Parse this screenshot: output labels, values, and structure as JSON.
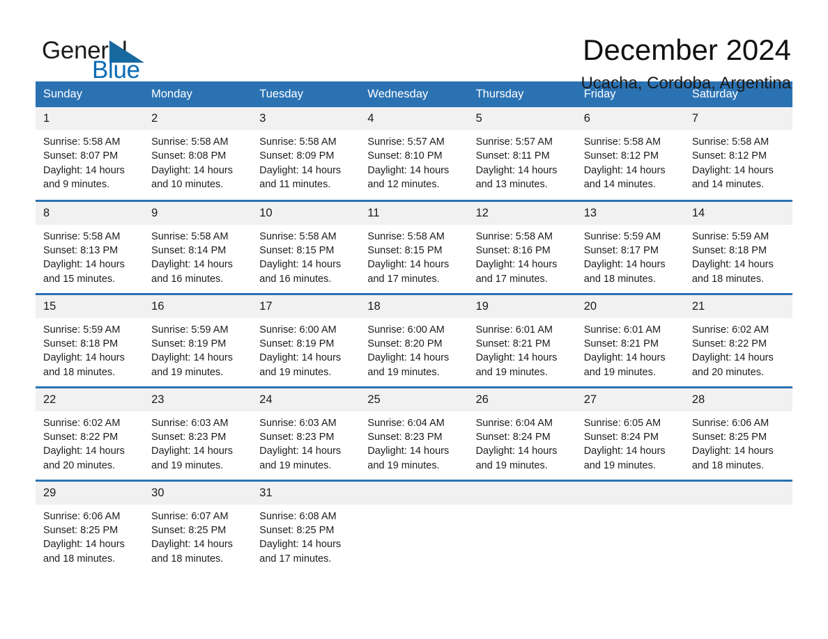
{
  "brand": {
    "name_part1": "General",
    "name_part2": "Blue",
    "triangle_color": "#17699f",
    "blue_color": "#0d6cb5"
  },
  "header": {
    "month_title": "December 2024",
    "location": "Ucacha, Cordoba, Argentina"
  },
  "theme": {
    "header_blue": "#2b72b3",
    "daynum_gray": "#f1f1f1",
    "text_dark": "#1c1c1c"
  },
  "calendar": {
    "weekday_headers": [
      "Sunday",
      "Monday",
      "Tuesday",
      "Wednesday",
      "Thursday",
      "Friday",
      "Saturday"
    ],
    "weeks": [
      [
        {
          "day": "1",
          "sunrise": "Sunrise: 5:58 AM",
          "sunset": "Sunset: 8:07 PM",
          "daylight_l1": "Daylight: 14 hours",
          "daylight_l2": "and 9 minutes."
        },
        {
          "day": "2",
          "sunrise": "Sunrise: 5:58 AM",
          "sunset": "Sunset: 8:08 PM",
          "daylight_l1": "Daylight: 14 hours",
          "daylight_l2": "and 10 minutes."
        },
        {
          "day": "3",
          "sunrise": "Sunrise: 5:58 AM",
          "sunset": "Sunset: 8:09 PM",
          "daylight_l1": "Daylight: 14 hours",
          "daylight_l2": "and 11 minutes."
        },
        {
          "day": "4",
          "sunrise": "Sunrise: 5:57 AM",
          "sunset": "Sunset: 8:10 PM",
          "daylight_l1": "Daylight: 14 hours",
          "daylight_l2": "and 12 minutes."
        },
        {
          "day": "5",
          "sunrise": "Sunrise: 5:57 AM",
          "sunset": "Sunset: 8:11 PM",
          "daylight_l1": "Daylight: 14 hours",
          "daylight_l2": "and 13 minutes."
        },
        {
          "day": "6",
          "sunrise": "Sunrise: 5:58 AM",
          "sunset": "Sunset: 8:12 PM",
          "daylight_l1": "Daylight: 14 hours",
          "daylight_l2": "and 14 minutes."
        },
        {
          "day": "7",
          "sunrise": "Sunrise: 5:58 AM",
          "sunset": "Sunset: 8:12 PM",
          "daylight_l1": "Daylight: 14 hours",
          "daylight_l2": "and 14 minutes."
        }
      ],
      [
        {
          "day": "8",
          "sunrise": "Sunrise: 5:58 AM",
          "sunset": "Sunset: 8:13 PM",
          "daylight_l1": "Daylight: 14 hours",
          "daylight_l2": "and 15 minutes."
        },
        {
          "day": "9",
          "sunrise": "Sunrise: 5:58 AM",
          "sunset": "Sunset: 8:14 PM",
          "daylight_l1": "Daylight: 14 hours",
          "daylight_l2": "and 16 minutes."
        },
        {
          "day": "10",
          "sunrise": "Sunrise: 5:58 AM",
          "sunset": "Sunset: 8:15 PM",
          "daylight_l1": "Daylight: 14 hours",
          "daylight_l2": "and 16 minutes."
        },
        {
          "day": "11",
          "sunrise": "Sunrise: 5:58 AM",
          "sunset": "Sunset: 8:15 PM",
          "daylight_l1": "Daylight: 14 hours",
          "daylight_l2": "and 17 minutes."
        },
        {
          "day": "12",
          "sunrise": "Sunrise: 5:58 AM",
          "sunset": "Sunset: 8:16 PM",
          "daylight_l1": "Daylight: 14 hours",
          "daylight_l2": "and 17 minutes."
        },
        {
          "day": "13",
          "sunrise": "Sunrise: 5:59 AM",
          "sunset": "Sunset: 8:17 PM",
          "daylight_l1": "Daylight: 14 hours",
          "daylight_l2": "and 18 minutes."
        },
        {
          "day": "14",
          "sunrise": "Sunrise: 5:59 AM",
          "sunset": "Sunset: 8:18 PM",
          "daylight_l1": "Daylight: 14 hours",
          "daylight_l2": "and 18 minutes."
        }
      ],
      [
        {
          "day": "15",
          "sunrise": "Sunrise: 5:59 AM",
          "sunset": "Sunset: 8:18 PM",
          "daylight_l1": "Daylight: 14 hours",
          "daylight_l2": "and 18 minutes."
        },
        {
          "day": "16",
          "sunrise": "Sunrise: 5:59 AM",
          "sunset": "Sunset: 8:19 PM",
          "daylight_l1": "Daylight: 14 hours",
          "daylight_l2": "and 19 minutes."
        },
        {
          "day": "17",
          "sunrise": "Sunrise: 6:00 AM",
          "sunset": "Sunset: 8:19 PM",
          "daylight_l1": "Daylight: 14 hours",
          "daylight_l2": "and 19 minutes."
        },
        {
          "day": "18",
          "sunrise": "Sunrise: 6:00 AM",
          "sunset": "Sunset: 8:20 PM",
          "daylight_l1": "Daylight: 14 hours",
          "daylight_l2": "and 19 minutes."
        },
        {
          "day": "19",
          "sunrise": "Sunrise: 6:01 AM",
          "sunset": "Sunset: 8:21 PM",
          "daylight_l1": "Daylight: 14 hours",
          "daylight_l2": "and 19 minutes."
        },
        {
          "day": "20",
          "sunrise": "Sunrise: 6:01 AM",
          "sunset": "Sunset: 8:21 PM",
          "daylight_l1": "Daylight: 14 hours",
          "daylight_l2": "and 19 minutes."
        },
        {
          "day": "21",
          "sunrise": "Sunrise: 6:02 AM",
          "sunset": "Sunset: 8:22 PM",
          "daylight_l1": "Daylight: 14 hours",
          "daylight_l2": "and 20 minutes."
        }
      ],
      [
        {
          "day": "22",
          "sunrise": "Sunrise: 6:02 AM",
          "sunset": "Sunset: 8:22 PM",
          "daylight_l1": "Daylight: 14 hours",
          "daylight_l2": "and 20 minutes."
        },
        {
          "day": "23",
          "sunrise": "Sunrise: 6:03 AM",
          "sunset": "Sunset: 8:23 PM",
          "daylight_l1": "Daylight: 14 hours",
          "daylight_l2": "and 19 minutes."
        },
        {
          "day": "24",
          "sunrise": "Sunrise: 6:03 AM",
          "sunset": "Sunset: 8:23 PM",
          "daylight_l1": "Daylight: 14 hours",
          "daylight_l2": "and 19 minutes."
        },
        {
          "day": "25",
          "sunrise": "Sunrise: 6:04 AM",
          "sunset": "Sunset: 8:23 PM",
          "daylight_l1": "Daylight: 14 hours",
          "daylight_l2": "and 19 minutes."
        },
        {
          "day": "26",
          "sunrise": "Sunrise: 6:04 AM",
          "sunset": "Sunset: 8:24 PM",
          "daylight_l1": "Daylight: 14 hours",
          "daylight_l2": "and 19 minutes."
        },
        {
          "day": "27",
          "sunrise": "Sunrise: 6:05 AM",
          "sunset": "Sunset: 8:24 PM",
          "daylight_l1": "Daylight: 14 hours",
          "daylight_l2": "and 19 minutes."
        },
        {
          "day": "28",
          "sunrise": "Sunrise: 6:06 AM",
          "sunset": "Sunset: 8:25 PM",
          "daylight_l1": "Daylight: 14 hours",
          "daylight_l2": "and 18 minutes."
        }
      ],
      [
        {
          "day": "29",
          "sunrise": "Sunrise: 6:06 AM",
          "sunset": "Sunset: 8:25 PM",
          "daylight_l1": "Daylight: 14 hours",
          "daylight_l2": "and 18 minutes."
        },
        {
          "day": "30",
          "sunrise": "Sunrise: 6:07 AM",
          "sunset": "Sunset: 8:25 PM",
          "daylight_l1": "Daylight: 14 hours",
          "daylight_l2": "and 18 minutes."
        },
        {
          "day": "31",
          "sunrise": "Sunrise: 6:08 AM",
          "sunset": "Sunset: 8:25 PM",
          "daylight_l1": "Daylight: 14 hours",
          "daylight_l2": "and 17 minutes."
        },
        {
          "day": "",
          "sunrise": "",
          "sunset": "",
          "daylight_l1": "",
          "daylight_l2": ""
        },
        {
          "day": "",
          "sunrise": "",
          "sunset": "",
          "daylight_l1": "",
          "daylight_l2": ""
        },
        {
          "day": "",
          "sunrise": "",
          "sunset": "",
          "daylight_l1": "",
          "daylight_l2": ""
        },
        {
          "day": "",
          "sunrise": "",
          "sunset": "",
          "daylight_l1": "",
          "daylight_l2": ""
        }
      ]
    ]
  }
}
